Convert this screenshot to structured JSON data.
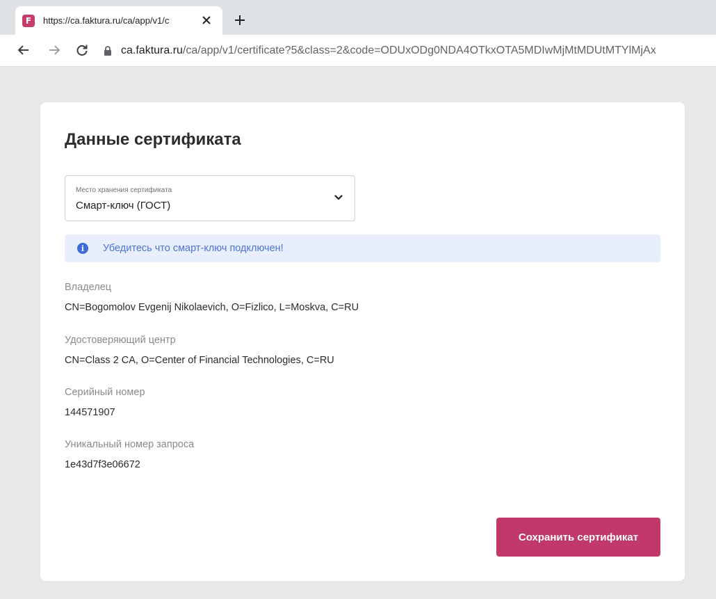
{
  "browser": {
    "tab_title": "https://ca.faktura.ru/ca/app/v1/c",
    "favicon_letter": "F",
    "url_host": "ca.faktura.ru",
    "url_path": "/ca/app/v1/certificate?5&class=2&code=ODUxODg0NDA4OTkxOTA5MDIwMjMtMDUtMTYlMjAx",
    "icons": [
      "close-icon",
      "plus-icon",
      "back-arrow-icon",
      "forward-arrow-icon",
      "reload-icon",
      "lock-icon"
    ]
  },
  "certificate": {
    "title": "Данные сертификата",
    "storage": {
      "label": "Место хранения сертификата",
      "value": "Смарт-ключ (ГОСТ)"
    },
    "alert": "Убедитесь что смарт-ключ подключен!",
    "fields": [
      {
        "label": "Владелец",
        "value": "CN=Bogomolov Evgenij Nikolaevich, O=Fizlico, L=Moskva, C=RU"
      },
      {
        "label": "Удостоверяющий центр",
        "value": "CN=Class 2 CA, O=Center of Financial Technologies, C=RU"
      },
      {
        "label": "Серийный номер",
        "value": "144571907"
      },
      {
        "label": "Уникальный номер запроса",
        "value": "1e43d7f3e06672"
      }
    ],
    "save_label": "Сохранить сертификат"
  },
  "colors": {
    "accent": "#c1386a",
    "info_bg": "#e9eefc",
    "info_text": "#4a74da",
    "page_bg": "#e8e8e8"
  }
}
